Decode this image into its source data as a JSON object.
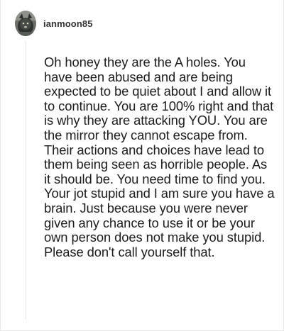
{
  "comment": {
    "username": "ianmoon85",
    "avatar_icon": "avatar-icon",
    "body": "Oh honey they are the A holes. You have been abused and are being expected to be quiet about I and allow it to continue. You are 100% right and that is why they are attacking YOU. You are the mirror they cannot escape from. Their actions and choices have lead to them being seen as horrible people. As it should be. You need time to find you. Your jot stupid and I am sure you have a brain. Just because you were never given any chance to use it or be your own person does not make you stupid. Please don't call yourself that."
  }
}
